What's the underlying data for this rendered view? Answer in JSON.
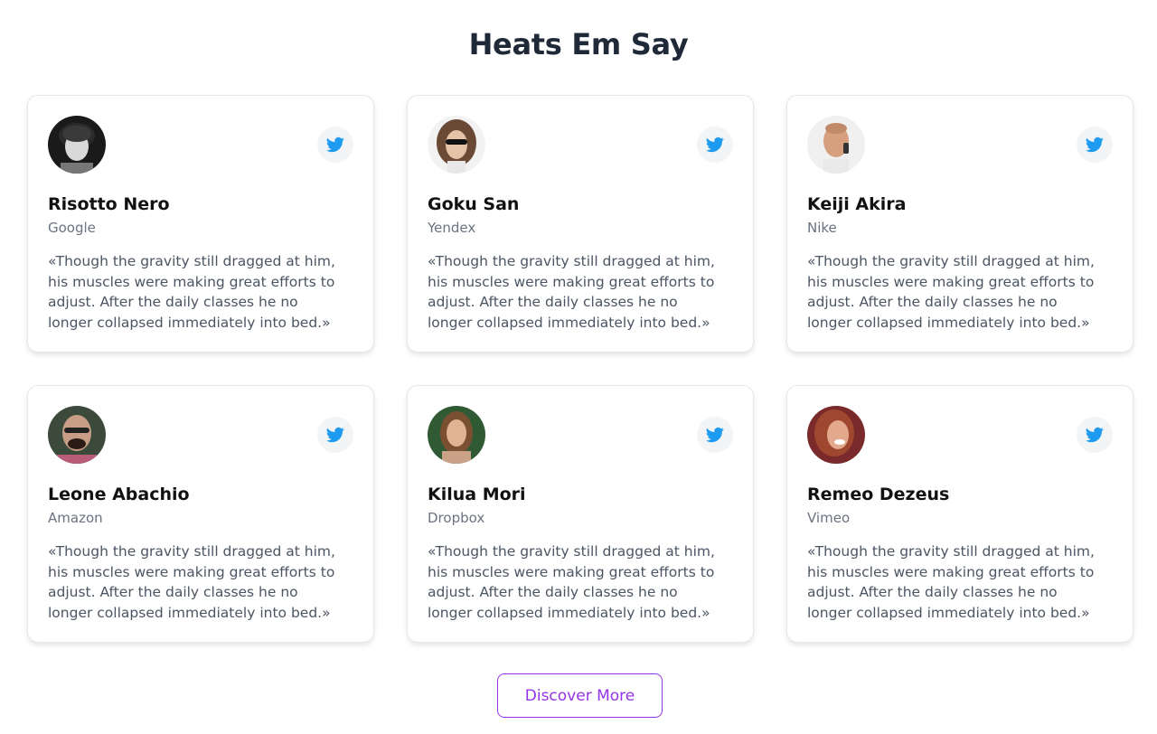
{
  "page": {
    "title": "Heats Em Say"
  },
  "testimonials": [
    {
      "name": "Risotto Nero",
      "company": "Google",
      "quote": "«Though the gravity still dragged at him, his muscles were making great efforts to adjust. After the daily classes he no longer collapsed immediately into bed.»",
      "social_icon": "twitter-icon"
    },
    {
      "name": "Goku San",
      "company": "Yendex",
      "quote": "«Though the gravity still dragged at him, his muscles were making great efforts to adjust. After the daily classes he no longer collapsed immediately into bed.»",
      "social_icon": "twitter-icon"
    },
    {
      "name": "Keiji Akira",
      "company": "Nike",
      "quote": "«Though the gravity still dragged at him, his muscles were making great efforts to adjust. After the daily classes he no longer collapsed immediately into bed.»",
      "social_icon": "twitter-icon"
    },
    {
      "name": "Leone Abachio",
      "company": "Amazon",
      "quote": "«Though the gravity still dragged at him, his muscles were making great efforts to adjust. After the daily classes he no longer collapsed immediately into bed.»",
      "social_icon": "twitter-icon"
    },
    {
      "name": "Kilua Mori",
      "company": "Dropbox",
      "quote": "«Though the gravity still dragged at him, his muscles were making great efforts to adjust. After the daily classes he no longer collapsed immediately into bed.»",
      "social_icon": "twitter-icon"
    },
    {
      "name": "Remeo Dezeus",
      "company": "Vimeo",
      "quote": "«Though the gravity still dragged at him, his muscles were making great efforts to adjust. After the daily classes he no longer collapsed immediately into bed.»",
      "social_icon": "twitter-icon"
    }
  ],
  "cta": {
    "discover_label": "Discover More"
  },
  "colors": {
    "accent": "#9333ea",
    "twitter": "#1d9bf0",
    "title": "#1f2937"
  }
}
